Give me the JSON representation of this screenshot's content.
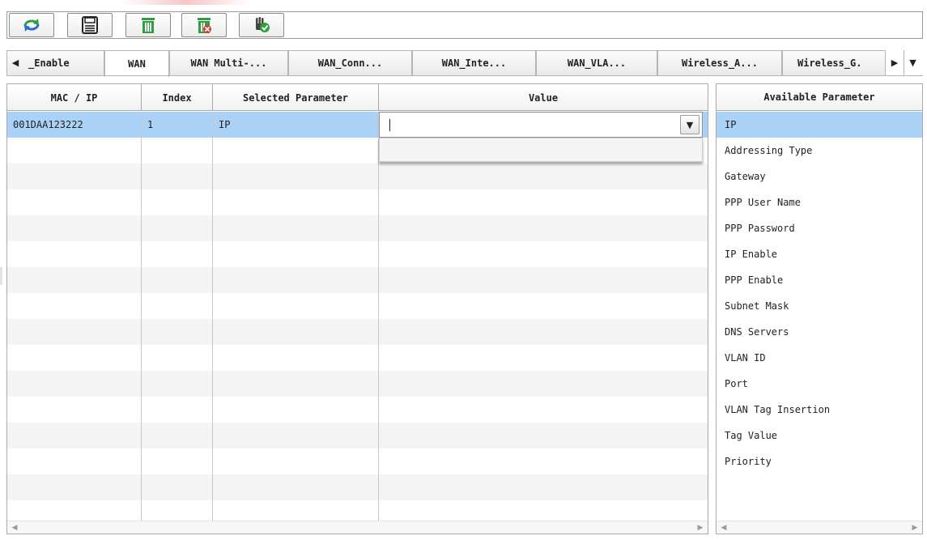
{
  "toolbar": {
    "buttons": [
      {
        "name": "refresh",
        "icon": "refresh-icon"
      },
      {
        "name": "save",
        "icon": "save-icon"
      },
      {
        "name": "delete",
        "icon": "trash-icon"
      },
      {
        "name": "delete-all",
        "icon": "trash-cancel-icon"
      },
      {
        "name": "apply",
        "icon": "hand-check-icon"
      }
    ]
  },
  "tabs": {
    "items": [
      "_Enable",
      "WAN",
      "WAN Multi-...",
      "WAN_Conn...",
      "WAN_Inte...",
      "WAN_VLA...",
      "Wireless_A...",
      "Wireless_G."
    ],
    "active": "WAN"
  },
  "grid": {
    "columns": [
      "MAC / IP",
      "Index",
      "Selected Parameter",
      "Value"
    ],
    "rows": [
      {
        "mac_ip": "001DAA123222",
        "index": "1",
        "parameter": "IP",
        "value": ""
      }
    ]
  },
  "available": {
    "header": "Available Parameter",
    "items": [
      "IP",
      "Addressing Type",
      "Gateway",
      "PPP User Name",
      "PPP Password",
      "IP Enable",
      "PPP Enable",
      "Subnet Mask",
      "DNS Servers",
      "VLAN ID",
      "Port",
      "VLAN Tag Insertion",
      "Tag Value",
      "Priority"
    ],
    "selected": "IP"
  },
  "colors": {
    "selection": "#a9d2f6",
    "alt_row": "#f4f4f4",
    "border": "#a9a9a9",
    "icon_green": "#2e9e3e",
    "icon_blue": "#1f6fcf",
    "icon_red": "#d23a2e"
  }
}
